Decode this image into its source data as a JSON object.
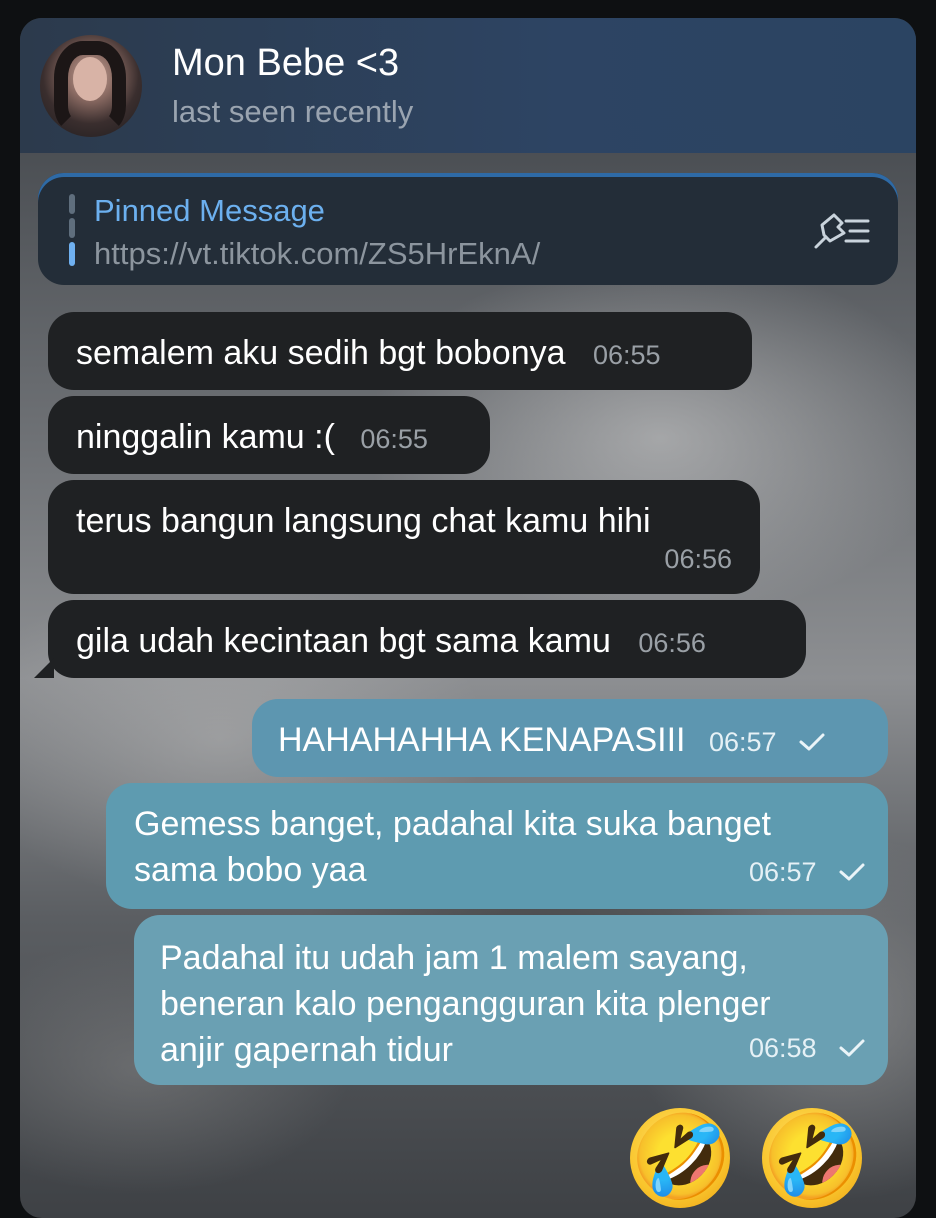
{
  "chat": {
    "name": "Mon Bebe <3",
    "status": "last seen recently"
  },
  "pinned": {
    "title": "Pinned Message",
    "text": "https://vt.tiktok.com/ZS5HrEknA/"
  },
  "messages": [
    {
      "text": "semalem aku sedih bgt bobonya",
      "time": "06:55"
    },
    {
      "text": "ninggalin kamu :(",
      "time": "06:55"
    },
    {
      "text": "terus bangun langsung chat kamu hihi",
      "time": "06:56"
    },
    {
      "text": "gila udah kecintaan bgt sama kamu",
      "time": "06:56"
    },
    {
      "text": "HAHAHAHHA KENAPASIII",
      "time": "06:57"
    },
    {
      "line1": "Gemess banget, padahal kita suka banget",
      "line2": "sama bobo yaa",
      "time": "06:57"
    },
    {
      "line1": "Padahal itu udah jam 1 malem sayang,",
      "line2": "beneran kalo pengangguran kita plenger",
      "line3": "anjir gapernah tidur",
      "time": "06:58"
    }
  ],
  "emojis": [
    "🤣",
    "🤣"
  ],
  "colors": {
    "header": "#2d4463",
    "incoming_bubble": "#1f2123",
    "outgoing_bubble": "#5d96b0",
    "accent": "#6cb0ef"
  }
}
